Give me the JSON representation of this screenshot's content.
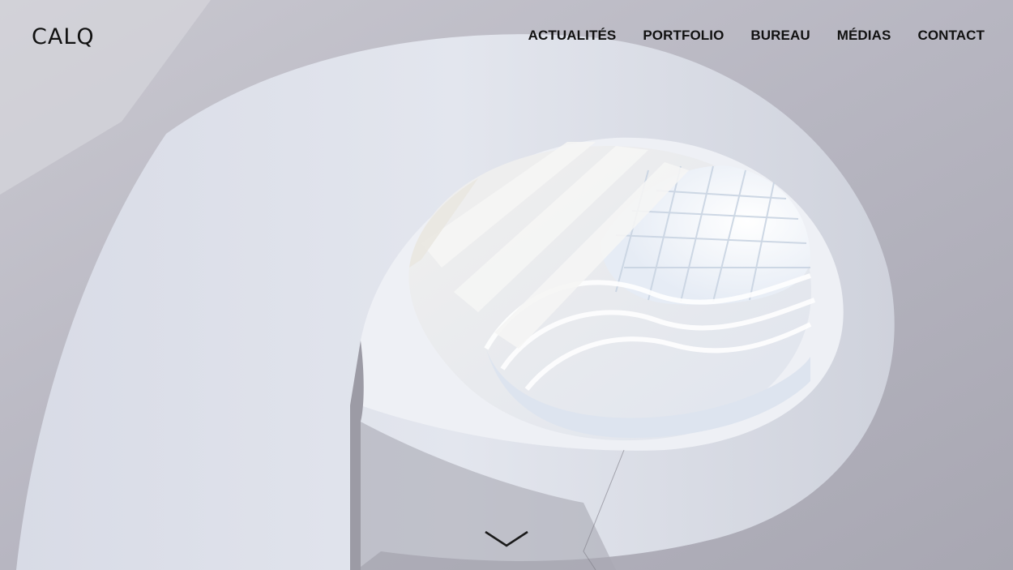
{
  "brand": {
    "logo_text": "CALQ"
  },
  "nav": {
    "items": [
      {
        "label": "ACTUALITÉS"
      },
      {
        "label": "PORTFOLIO"
      },
      {
        "label": "BUREAU"
      },
      {
        "label": "MÉDIAS"
      },
      {
        "label": "CONTACT"
      }
    ]
  },
  "hero": {
    "image_subject": "spiral-staircase-architecture-icon",
    "scroll_icon": "chevron-down-icon"
  },
  "colors": {
    "background": "#b4b3bd",
    "text": "#111111"
  }
}
